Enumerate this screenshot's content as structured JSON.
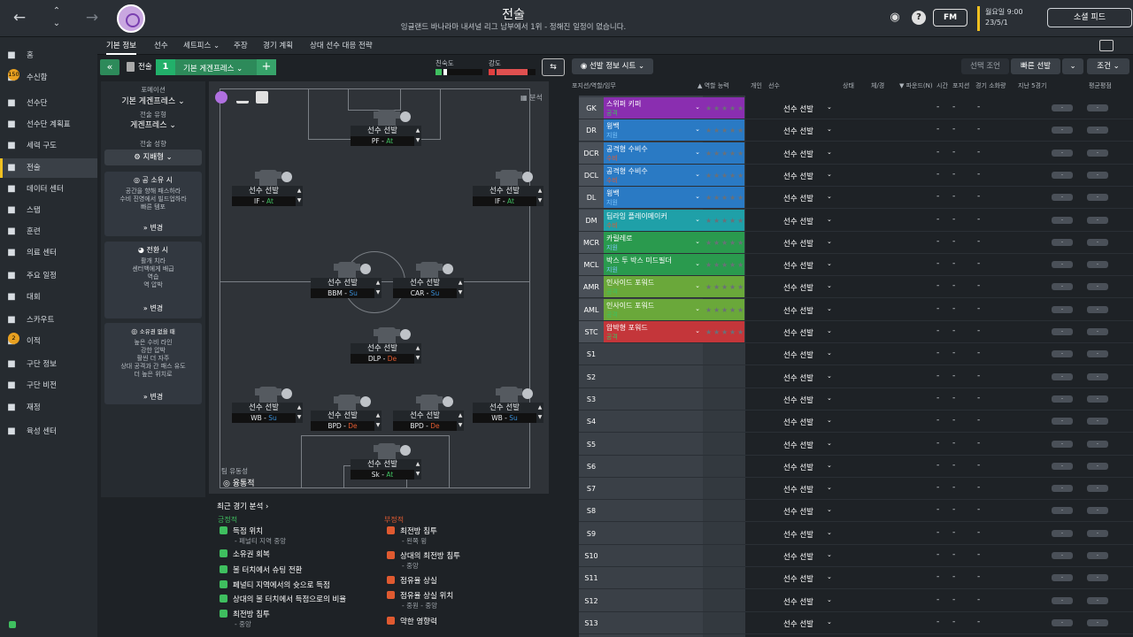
{
  "header": {
    "title": "전술",
    "subtitle": "잉글랜드 바나라마 내셔널 리그 남부에서 1위 - 정해진 일정이 없습니다.",
    "fm_label": "FM",
    "date_line1": "월요일 9:00",
    "date_line2": "23/5/1",
    "social_label": "소셜 피드",
    "back_icon": "arrow-left-icon",
    "forward_icon": "arrow-right-icon"
  },
  "sidebar": {
    "items": [
      {
        "label": "홈",
        "icon": "home-icon"
      },
      {
        "label": "수신함",
        "icon": "inbox-icon",
        "badge": "150"
      },
      {
        "label": "선수단",
        "icon": "shirt-icon"
      },
      {
        "label": "선수단 계획표",
        "icon": "clipboard-icon"
      },
      {
        "label": "세력 구도",
        "icon": "dynamics-icon"
      },
      {
        "label": "전술",
        "icon": "tactics-icon",
        "active": true
      },
      {
        "label": "데이터 센터",
        "icon": "data-icon"
      },
      {
        "label": "스탭",
        "icon": "staff-icon"
      },
      {
        "label": "훈련",
        "icon": "training-icon"
      },
      {
        "label": "의료 센터",
        "icon": "medical-icon"
      },
      {
        "label": "주요 일정",
        "icon": "calendar-icon"
      },
      {
        "label": "대회",
        "icon": "trophy-icon"
      },
      {
        "label": "스카우트",
        "icon": "scout-icon"
      },
      {
        "label": "이적",
        "icon": "transfer-icon",
        "badge": "2"
      },
      {
        "label": "구단 정보",
        "icon": "club-icon"
      },
      {
        "label": "구단 비전",
        "icon": "vision-icon"
      },
      {
        "label": "재정",
        "icon": "finance-icon"
      },
      {
        "label": "육성 센터",
        "icon": "development-icon"
      }
    ]
  },
  "tabs": [
    "기본 정보",
    "선수",
    "세트피스",
    "주장",
    "경기 계획",
    "상대 선수 대응 전략"
  ],
  "toolbar": {
    "tactic_label": "전술",
    "slot_number": "1",
    "formation_name": "기본 게겐프레스",
    "plus": "+",
    "fluidity_label": "친숙도",
    "intensity_label": "강도",
    "fluidity_value": 0.55,
    "intensity_value": 0.8,
    "mini_btn": "⇆"
  },
  "left_panel": {
    "formation_label": "포메이션",
    "formation_value": "기본 게겐프레스",
    "style_label": "전술 유형",
    "style_value": "게겐프레스",
    "mentality_label": "전술 성향",
    "mentality_value": "지배형",
    "in_possession_title": "공 소유 시",
    "in_possession_lines": [
      "공간을 향해 패스하라",
      "수비 진영에서 빌드업하라",
      "빠른 템포"
    ],
    "transition_title": "전환 시",
    "transition_lines": [
      "활개 치라",
      "센터백에게 배급",
      "역습",
      "역 압박"
    ],
    "out_possession_title": "소유권 없을 때",
    "out_possession_lines": [
      "높은 수비 라인",
      "강한 압박",
      "활씬 더 자주",
      "상대 공격과 간 패스 유도",
      "더 높은 위치로"
    ],
    "change_label": "변경"
  },
  "pitch": {
    "analysis_label": "분석",
    "team_fluidity_label": "팀 유동성",
    "team_fluidity_value": "융통적",
    "players": [
      {
        "name": "선수 선발",
        "role": "PF",
        "duty": "At",
        "duty_color": "#3fbf5f"
      },
      {
        "name": "선수 선발",
        "role": "IF",
        "duty": "At",
        "duty_color": "#3fbf5f"
      },
      {
        "name": "선수 선발",
        "role": "IF",
        "duty": "At",
        "duty_color": "#3fbf5f"
      },
      {
        "name": "선수 선발",
        "role": "BBM",
        "duty": "Su",
        "duty_color": "#3a8fd8"
      },
      {
        "name": "선수 선발",
        "role": "CAR",
        "duty": "Su",
        "duty_color": "#3a8fd8"
      },
      {
        "name": "선수 선발",
        "role": "DLP",
        "duty": "De",
        "duty_color": "#e05a30"
      },
      {
        "name": "선수 선발",
        "role": "WB",
        "duty": "Su",
        "duty_color": "#3a8fd8"
      },
      {
        "name": "선수 선발",
        "role": "BPD",
        "duty": "De",
        "duty_color": "#e05a30"
      },
      {
        "name": "선수 선발",
        "role": "BPD",
        "duty": "De",
        "duty_color": "#e05a30"
      },
      {
        "name": "선수 선발",
        "role": "WB",
        "duty": "Su",
        "duty_color": "#3a8fd8"
      },
      {
        "name": "선수 선발",
        "role": "Sk",
        "duty": "At",
        "duty_color": "#3fbf5f"
      }
    ]
  },
  "analysis": {
    "title": "최근 경기 분석",
    "positive_label": "긍정적",
    "negative_label": "부정적",
    "positives": [
      {
        "title": "득점 위치",
        "sub": "- 페널티 지역 중앙"
      },
      {
        "title": "소유권 회복",
        "sub": ""
      },
      {
        "title": "볼 터치에서 슈팅 전환",
        "sub": ""
      },
      {
        "title": "페널티 지역에서의 슛으로 득점",
        "sub": ""
      },
      {
        "title": "상대의 볼 터치에서 득점으로의 비율",
        "sub": ""
      },
      {
        "title": "최전방 침투",
        "sub": "- 중앙"
      }
    ],
    "negatives": [
      {
        "title": "최전방 침투",
        "sub": "- 왼쪽 윙"
      },
      {
        "title": "상대의 최전방 침투",
        "sub": "- 중앙"
      },
      {
        "title": "점유율 상실",
        "sub": ""
      },
      {
        "title": "점유율 상실 위치",
        "sub": "- 중원 - 중앙"
      },
      {
        "title": "약한 영향력",
        "sub": ""
      }
    ]
  },
  "right_toolbar": {
    "view_label": "선발 정보 시트",
    "select_label": "선택 조언",
    "quick_pick_label": "빠른 선발",
    "filter_label": "조건"
  },
  "columns": [
    "포지션/역할/임무",
    "역할 능력",
    "개인",
    "선수",
    "상태",
    "체/경",
    "파운드(N)",
    "시간",
    "포지션",
    "경기 소화량",
    "지난 5경기",
    "평균평점"
  ],
  "rows": [
    {
      "pos": "GK",
      "role": "스위퍼 키퍼",
      "duty": "공격",
      "duty_color": "#3fbf5f",
      "bg": "#8a2eb0"
    },
    {
      "pos": "DR",
      "role": "윙백",
      "duty": "지원",
      "duty_color": "#7fc8ff",
      "bg": "#2a7ac4"
    },
    {
      "pos": "DCR",
      "role": "공격형 수비수",
      "duty": "수비",
      "duty_color": "#e05a30",
      "bg": "#2a7ac4"
    },
    {
      "pos": "DCL",
      "role": "공격형 수비수",
      "duty": "수비",
      "duty_color": "#e05a30",
      "bg": "#2a7ac4"
    },
    {
      "pos": "DL",
      "role": "윙백",
      "duty": "지원",
      "duty_color": "#7fc8ff",
      "bg": "#2a7ac4"
    },
    {
      "pos": "DM",
      "role": "딥라잉 플레이메이커",
      "duty": "수비",
      "duty_color": "#e05a30",
      "bg": "#1fa0a8"
    },
    {
      "pos": "MCR",
      "role": "카릴레로",
      "duty": "지원",
      "duty_color": "#7fc8ff",
      "bg": "#2a9a4e"
    },
    {
      "pos": "MCL",
      "role": "박스 투 박스 미드필더",
      "duty": "지원",
      "duty_color": "#7fc8ff",
      "bg": "#2a9a4e"
    },
    {
      "pos": "AMR",
      "role": "인사이드 포워드",
      "duty": "공격",
      "duty_color": "#3fbf5f",
      "bg": "#6aa83a"
    },
    {
      "pos": "AML",
      "role": "인사이드 포워드",
      "duty": "공격",
      "duty_color": "#3fbf5f",
      "bg": "#6aa83a"
    },
    {
      "pos": "STC",
      "role": "압박형 포워드",
      "duty": "공격",
      "duty_color": "#3fbf5f",
      "bg": "#c4363a"
    },
    {
      "pos": "S1"
    },
    {
      "pos": "S2"
    },
    {
      "pos": "S3"
    },
    {
      "pos": "S4"
    },
    {
      "pos": "S5"
    },
    {
      "pos": "S6"
    },
    {
      "pos": "S7"
    },
    {
      "pos": "S8"
    },
    {
      "pos": "S9"
    },
    {
      "pos": "S10"
    },
    {
      "pos": "S11"
    },
    {
      "pos": "S12"
    },
    {
      "pos": "S13"
    }
  ],
  "player_cell": "선수 선발",
  "dash": "-",
  "pill": "-"
}
